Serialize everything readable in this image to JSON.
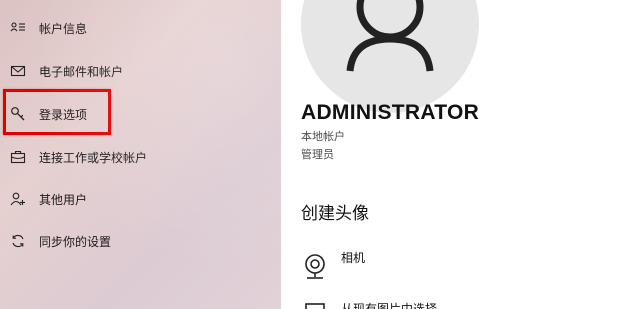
{
  "sidebar": {
    "items": [
      {
        "label": "帐户信息",
        "icon": "account-info-icon"
      },
      {
        "label": "电子邮件和帐户",
        "icon": "mail-icon"
      },
      {
        "label": "登录选项",
        "icon": "key-icon",
        "highlighted": true
      },
      {
        "label": "连接工作或学校帐户",
        "icon": "briefcase-icon"
      },
      {
        "label": "其他用户",
        "icon": "add-person-icon"
      },
      {
        "label": "同步你的设置",
        "icon": "sync-icon"
      }
    ]
  },
  "profile": {
    "name": "ADMINISTRATOR",
    "account_type": "本地帐户",
    "role": "管理员"
  },
  "create_avatar": {
    "title": "创建头像",
    "options": [
      {
        "label": "相机",
        "icon": "camera-icon"
      },
      {
        "label": "从现有图片中选择",
        "icon": "browse-icon"
      }
    ]
  },
  "colors": {
    "highlight_border": "#e30000",
    "content_bg": "#ffffff",
    "avatar_bg": "#e6e6e6"
  }
}
